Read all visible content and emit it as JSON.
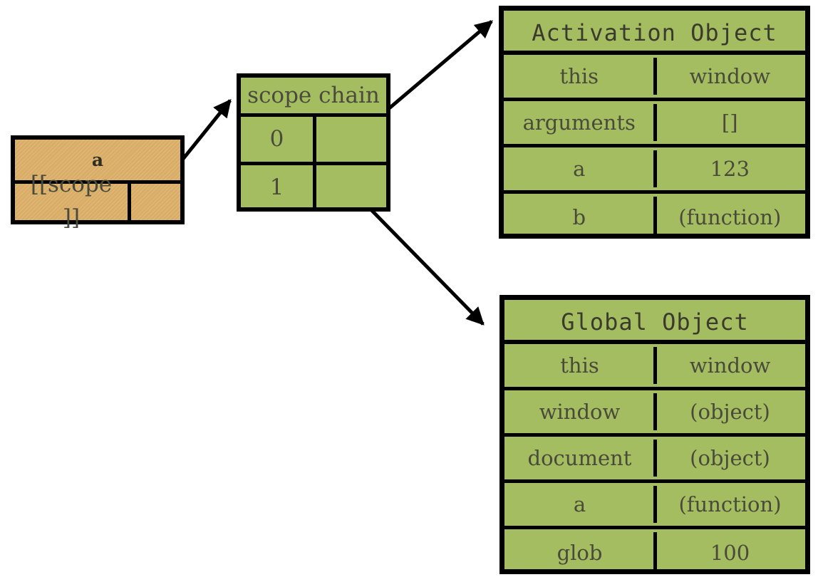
{
  "diagram": {
    "title": "JavaScript scope chain diagram",
    "colors": {
      "function_box_fill": "#d9ad66",
      "object_box_fill": "#a4bd60",
      "border": "#000000",
      "text": "#4a4a3b"
    }
  },
  "function_box": {
    "name": "a",
    "property_label": "[[scope\n]]",
    "pointer_label": ""
  },
  "scope_chain": {
    "header": "scope chain",
    "entries": [
      {
        "index": "0",
        "pointer": ""
      },
      {
        "index": "1",
        "pointer": ""
      }
    ]
  },
  "activation_object": {
    "title": "Activation Object",
    "rows": [
      {
        "key": "this",
        "value": "window"
      },
      {
        "key": "arguments",
        "value": "[]"
      },
      {
        "key": "a",
        "value": "123"
      },
      {
        "key": "b",
        "value": "(function)"
      }
    ]
  },
  "global_object": {
    "title": "Global Object",
    "rows": [
      {
        "key": "this",
        "value": "window"
      },
      {
        "key": "window",
        "value": "(object)"
      },
      {
        "key": "document",
        "value": "(object)"
      },
      {
        "key": "a",
        "value": "(function)"
      },
      {
        "key": "glob",
        "value": "100"
      }
    ]
  },
  "arrows": [
    {
      "name": "scope-to-scopechain",
      "from": "function_box.pointer",
      "to": "scope_chain.header"
    },
    {
      "name": "slot0-to-activation",
      "from": "scope_chain.entries.0",
      "to": "activation_object.title"
    },
    {
      "name": "slot1-to-global",
      "from": "scope_chain.entries.1",
      "to": "global_object.title"
    }
  ]
}
